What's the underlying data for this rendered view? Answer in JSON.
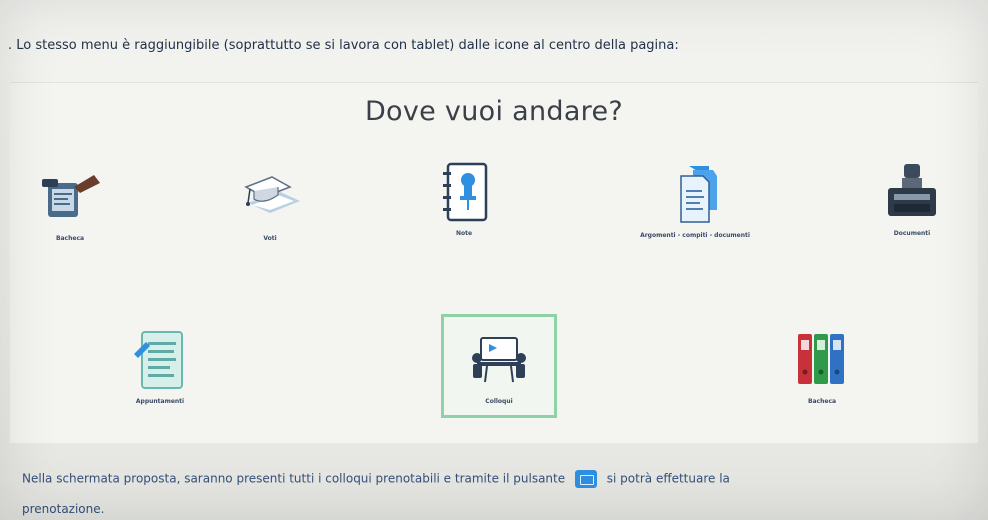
{
  "intro_text": ". Lo stesso menu è raggiungibile (soprattutto se si lavora con tablet) dalle icone al centro della pagina:",
  "heading": "Dove vuoi andare?",
  "tiles": [
    {
      "label": "Bacheca",
      "icon": "dashboard-icon"
    },
    {
      "label": "Voti",
      "icon": "graduation-cap-icon"
    },
    {
      "label": "Note",
      "icon": "pinned-notebook-icon"
    },
    {
      "label": "Argomenti - compiti - documenti",
      "icon": "documents-icon"
    },
    {
      "label": "Documenti",
      "icon": "printer-icon"
    },
    {
      "label": "Appuntamenti",
      "icon": "appointments-icon"
    },
    {
      "label": "Colloqui",
      "icon": "meeting-icon"
    },
    {
      "label": "Bacheca",
      "icon": "binders-icon"
    }
  ],
  "footer_text_before": "Nella schermata proposta, saranno presenti tutti i colloqui prenotabili e tramite il pulsante",
  "footer_text_after": "si potrà effettuare la",
  "footer_text_line2": "prenotazione.",
  "colors": {
    "accent": "#2f8fe0",
    "selected_border": "#8fd2a9",
    "heading": "#3b3f48"
  }
}
